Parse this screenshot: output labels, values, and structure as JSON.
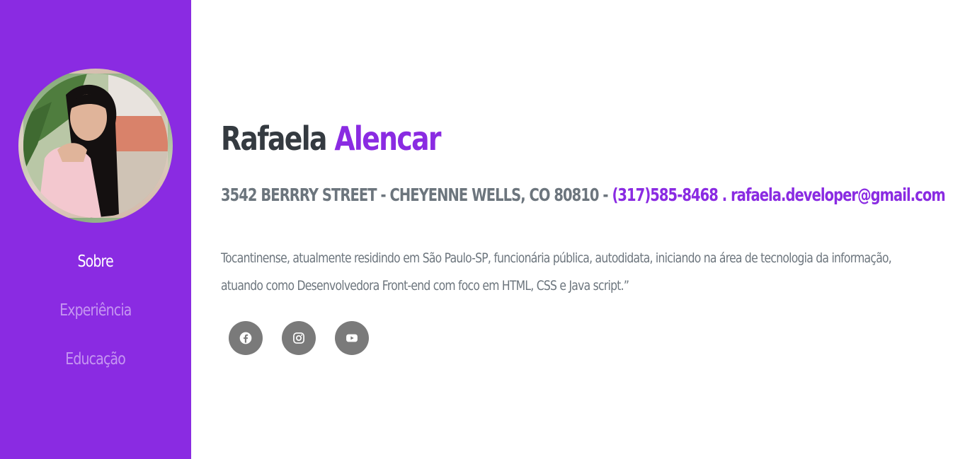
{
  "profile": {
    "first_name": "Rafaela",
    "last_name": "Alencar",
    "address": "3542 BERRRY STREET - CHEYENNE WELLS, CO 80810 -",
    "phone": "(317)585-8468",
    "separator": ".",
    "email": "rafaela.developer@gmail.com",
    "bio": "Tocantinense, atualmente residindo em São Paulo-SP, funcionária pública, autodidata, iniciando na área de tecnologia da informação, atuando como Desenvolvedora Front-end com foco em HTML, CSS e Java script.”"
  },
  "nav": {
    "items": [
      {
        "label": "Sobre",
        "active": true
      },
      {
        "label": "Experiência",
        "active": false
      },
      {
        "label": "Educação",
        "active": false
      }
    ]
  },
  "social": [
    {
      "icon": "facebook-icon"
    },
    {
      "icon": "instagram-icon"
    },
    {
      "icon": "youtube-icon"
    }
  ],
  "colors": {
    "sidebar": "#8a2be2",
    "accent": "#8a2be2",
    "heading": "#343a40",
    "muted": "#6c757d",
    "social_bg": "#7a7a7a"
  }
}
